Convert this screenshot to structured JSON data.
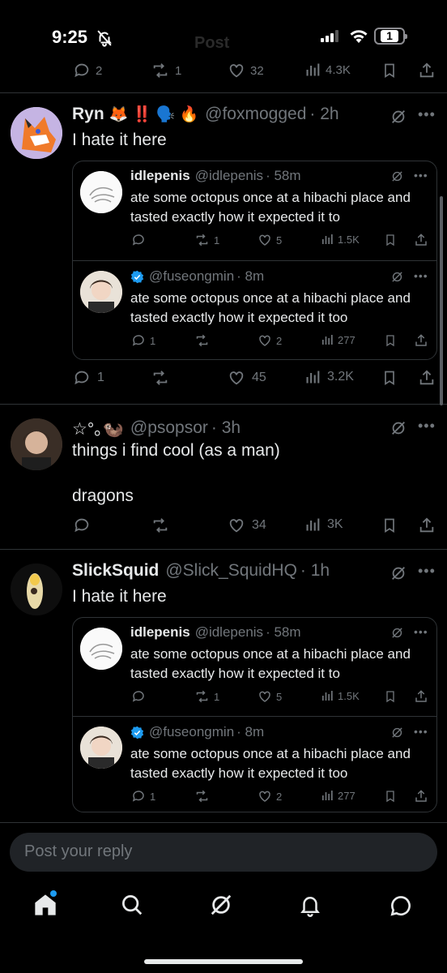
{
  "status_bar": {
    "time": "9:25",
    "battery": "1",
    "ghost_title": "Post"
  },
  "prev_post_actions": {
    "replies": "2",
    "reposts": "1",
    "likes": "32",
    "views": "4.3K"
  },
  "posts": [
    {
      "name": "Ryn",
      "name_emoji": "🦊 ‼️ 🗣️ 🔥",
      "handle": "@foxmogged",
      "time": "· 2h",
      "text": "I hate it here",
      "quotes": [
        {
          "name": "idlepenis",
          "handle": "@idlepenis",
          "time": "· 58m",
          "text": "ate some octopus once at a hibachi place and tasted exactly how it expected it to",
          "replies": "",
          "reposts": "1",
          "likes": "5",
          "views": "1.5K"
        },
        {
          "name": "",
          "handle": "@fuseongmin",
          "time": "· 8m",
          "verified": true,
          "text": "ate some octopus once at a hibachi place and tasted exactly how it expected it too",
          "replies": "1",
          "reposts": "",
          "likes": "2",
          "views": "277"
        }
      ],
      "replies": "1",
      "reposts": "",
      "likes": "45",
      "views": "3.2K"
    },
    {
      "name": "☆°｡🦦",
      "name_emoji": "",
      "handle": "@psopsor",
      "time": "· 3h",
      "text": "things i find cool (as a man)\n\ndragons",
      "replies": "",
      "reposts": "",
      "likes": "34",
      "views": "3K"
    },
    {
      "name": "SlickSquid",
      "name_emoji": "",
      "handle": "@Slick_SquidHQ",
      "time": "· 1h",
      "text": "I hate it here",
      "quotes": [
        {
          "name": "idlepenis",
          "handle": "@idlepenis",
          "time": "· 58m",
          "text": "ate some octopus once at a hibachi place and tasted exactly how it expected it to",
          "replies": "",
          "reposts": "1",
          "likes": "5",
          "views": "1.5K"
        },
        {
          "name": "",
          "handle": "@fuseongmin",
          "time": "· 8m",
          "verified": true,
          "text": "ate some octopus once at a hibachi place and tasted exactly how it expected it too",
          "replies": "1",
          "reposts": "",
          "likes": "2",
          "views": "277"
        }
      ]
    }
  ],
  "reply_input": {
    "placeholder": "Post your reply"
  },
  "tabs": [
    "home-icon",
    "search-icon",
    "grok-icon",
    "notifications-icon",
    "messages-icon"
  ],
  "colors": {
    "background": "#000000",
    "text": "#e7e9ea",
    "muted": "#71767b",
    "accent": "#1d9bf0",
    "verified": "#1d9bf0",
    "divider": "#2f3336"
  }
}
